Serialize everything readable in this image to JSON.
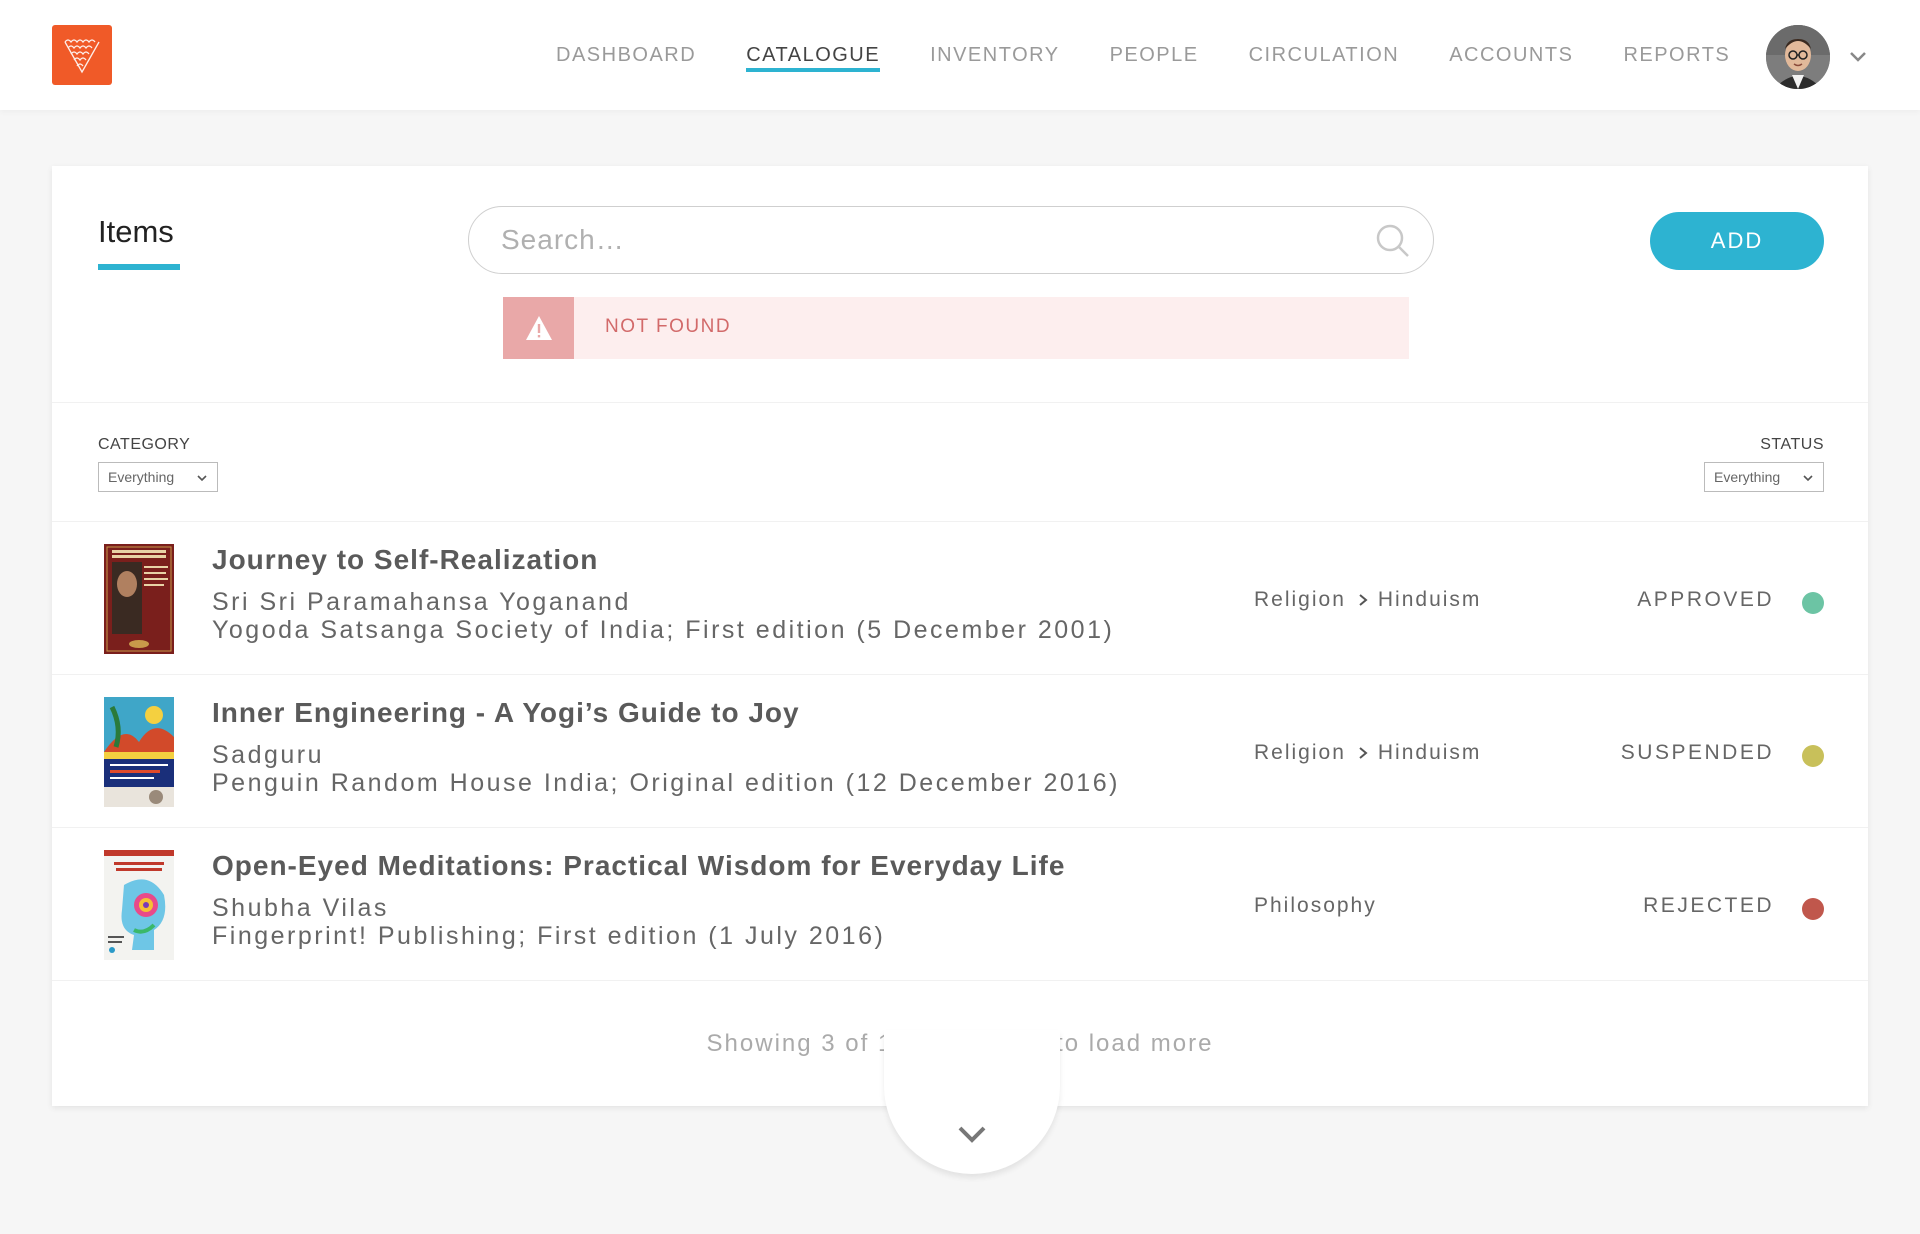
{
  "nav": {
    "items": [
      "DASHBOARD",
      "CATALOGUE",
      "INVENTORY",
      "PEOPLE",
      "CIRCULATION",
      "ACCOUNTS",
      "REPORTS"
    ],
    "active": "CATALOGUE"
  },
  "page": {
    "title": "Items"
  },
  "search": {
    "placeholder": "Search…",
    "value": ""
  },
  "add_button": "ADD",
  "alert": {
    "message": "NOT FOUND"
  },
  "filters": {
    "category_label": "CATEGORY",
    "category_value": "Everything",
    "status_label": "STATUS",
    "status_value": "Everything"
  },
  "items": [
    {
      "title": "Journey to Self-Realization",
      "author": "Sri Sri Paramahansa Yoganand",
      "publisher": "Yogoda Satsanga Society of India; First edition (5 December 2001)",
      "category": [
        "Religion",
        "Hinduism"
      ],
      "status": "APPROVED",
      "status_color": "#6cc4a4"
    },
    {
      "title": "Inner Engineering - A Yogi’s Guide to Joy",
      "author": "Sadguru",
      "publisher": "Penguin Random House India; Original edition (12 December 2016)",
      "category": [
        "Religion",
        "Hinduism"
      ],
      "status": "SUSPENDED",
      "status_color": "#c8c05a"
    },
    {
      "title": "Open-Eyed Meditations: Practical Wisdom for Everyday Life",
      "author": "Shubha Vilas",
      "publisher": "Fingerprint! Publishing; First edition (1 July 2016)",
      "category": [
        "Philosophy"
      ],
      "status": "REJECTED",
      "status_color": "#c0574c"
    }
  ],
  "load_more": "Showing 3 of 10, click here to load more",
  "colors": {
    "accent": "#2db3d1",
    "logo": "#f05a28",
    "alert_bg": "#fdeeee",
    "alert_icon_bg": "#e9a8a8",
    "alert_text": "#d26a6a"
  }
}
